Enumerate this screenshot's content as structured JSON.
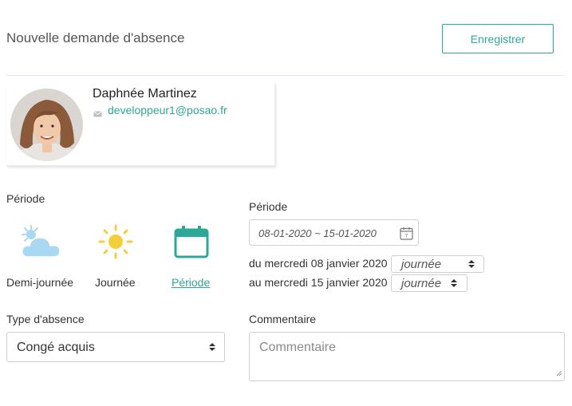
{
  "header": {
    "title": "Nouvelle demande d'absence",
    "save_label": "Enregistrer"
  },
  "user": {
    "name": "Daphnée Martinez",
    "email": "developpeur1@posao.fr"
  },
  "period_picker": {
    "label": "Période",
    "options": [
      {
        "label": "Demi-journée",
        "icon": "partly-cloudy-icon",
        "selected": false
      },
      {
        "label": "Journée",
        "icon": "sun-icon",
        "selected": false
      },
      {
        "label": "Période",
        "icon": "calendar-icon",
        "selected": true
      }
    ]
  },
  "period_range": {
    "label": "Période",
    "value": "08-01-2020 ~ 15-01-2020",
    "start_text": "du mercredi 08 janvier 2020",
    "start_select": "journée",
    "end_text": "au mercredi 15 janvier 2020",
    "end_select": "journée"
  },
  "absence_type": {
    "label": "Type d'absence",
    "value": "Congé acquis"
  },
  "comment": {
    "label": "Commentaire",
    "placeholder": "Commentaire"
  },
  "colors": {
    "accent": "#2ca898",
    "sun": "#f5cf3a",
    "cloud": "#a9d8f2"
  }
}
